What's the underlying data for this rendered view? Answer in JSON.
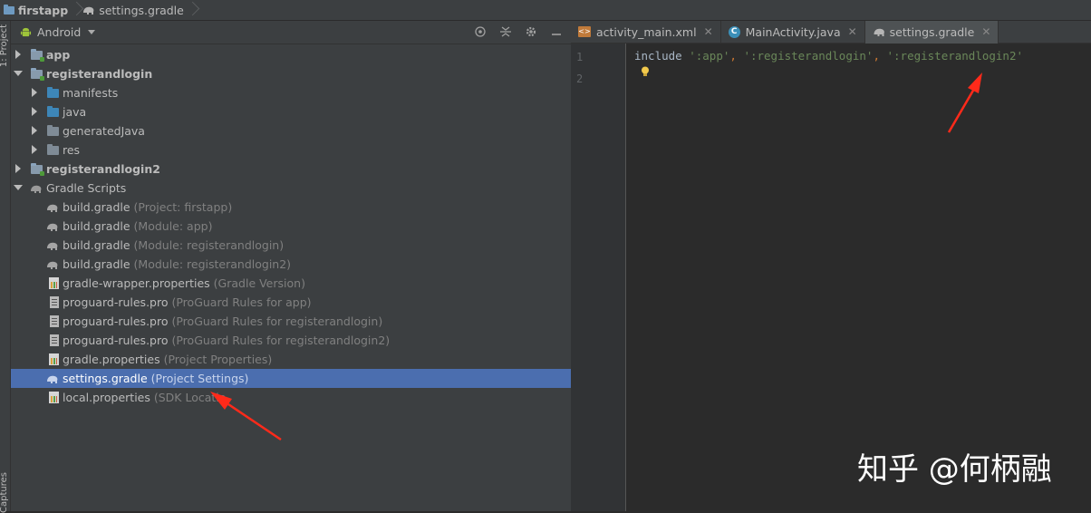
{
  "breadcrumb": {
    "project": "firstapp",
    "file": "settings.gradle"
  },
  "left_stripe": {
    "project_tab": "1: Project",
    "captures_tab": "Captures"
  },
  "project_panel": {
    "view_selector": "Android",
    "tree": [
      {
        "label": "app",
        "hint": "",
        "depth": 0,
        "expanded": false,
        "kind": "module"
      },
      {
        "label": "registerandlogin",
        "hint": "",
        "depth": 0,
        "expanded": true,
        "kind": "module"
      },
      {
        "label": "manifests",
        "hint": "",
        "depth": 1,
        "expanded": false,
        "kind": "folder-blue"
      },
      {
        "label": "java",
        "hint": "",
        "depth": 1,
        "expanded": false,
        "kind": "folder-blue"
      },
      {
        "label": "generatedJava",
        "hint": "",
        "depth": 1,
        "expanded": false,
        "kind": "folder-gen"
      },
      {
        "label": "res",
        "hint": "",
        "depth": 1,
        "expanded": false,
        "kind": "folder-gray"
      },
      {
        "label": "registerandlogin2",
        "hint": "",
        "depth": 0,
        "expanded": false,
        "kind": "module"
      },
      {
        "label": "Gradle Scripts",
        "hint": "",
        "depth": 0,
        "expanded": true,
        "kind": "gradle"
      },
      {
        "label": "build.gradle",
        "hint": "(Project: firstapp)",
        "depth": 1,
        "kind": "gradle-file"
      },
      {
        "label": "build.gradle",
        "hint": "(Module: app)",
        "depth": 1,
        "kind": "gradle-file"
      },
      {
        "label": "build.gradle",
        "hint": "(Module: registerandlogin)",
        "depth": 1,
        "kind": "gradle-file"
      },
      {
        "label": "build.gradle",
        "hint": "(Module: registerandlogin2)",
        "depth": 1,
        "kind": "gradle-file"
      },
      {
        "label": "gradle-wrapper.properties",
        "hint": "(Gradle Version)",
        "depth": 1,
        "kind": "props-file"
      },
      {
        "label": "proguard-rules.pro",
        "hint": "(ProGuard Rules for app)",
        "depth": 1,
        "kind": "pro-file"
      },
      {
        "label": "proguard-rules.pro",
        "hint": "(ProGuard Rules for registerandlogin)",
        "depth": 1,
        "kind": "pro-file"
      },
      {
        "label": "proguard-rules.pro",
        "hint": "(ProGuard Rules for registerandlogin2)",
        "depth": 1,
        "kind": "pro-file"
      },
      {
        "label": "gradle.properties",
        "hint": "(Project Properties)",
        "depth": 1,
        "kind": "props-file"
      },
      {
        "label": "settings.gradle",
        "hint": "(Project Settings)",
        "depth": 1,
        "kind": "gradle-file",
        "selected": true
      },
      {
        "label": "local.properties",
        "hint": "(SDK Locatio",
        "depth": 1,
        "kind": "props-file"
      }
    ]
  },
  "editor": {
    "tabs": [
      {
        "label": "activity_main.xml",
        "icon": "xml-file-icon",
        "active": false
      },
      {
        "label": "MainActivity.java",
        "icon": "java-class-icon",
        "active": false
      },
      {
        "label": "settings.gradle",
        "icon": "gradle-file-icon",
        "active": true
      }
    ],
    "line_numbers": [
      "1",
      "2"
    ],
    "code": {
      "keyword": "include",
      "s1": "':app'",
      "s2": "':registerandlogin'",
      "s3": "':registerandlogin2'",
      "comma": ","
    }
  },
  "watermark": "知乎 @何柄融",
  "colors": {
    "selection": "#4b6eaf",
    "panel_bg": "#3c3f41",
    "editor_bg": "#2b2b2b",
    "string": "#6a8759",
    "arrow": "#ff2a1a"
  }
}
